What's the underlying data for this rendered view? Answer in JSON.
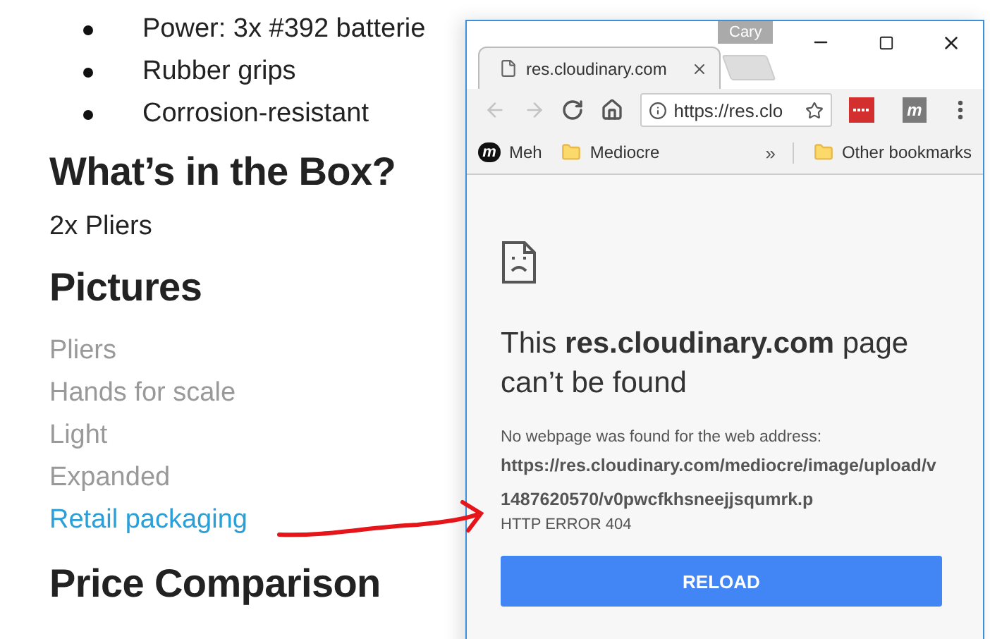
{
  "article": {
    "bullets": [
      "Power: 3x #392 batterie",
      "Rubber grips",
      "Corrosion-resistant"
    ],
    "box_heading": "What’s in the Box?",
    "box_items": [
      "2x Pliers"
    ],
    "pictures_heading": "Pictures",
    "picture_links": [
      {
        "label": "Pliers",
        "selected": false
      },
      {
        "label": "Hands for scale",
        "selected": false
      },
      {
        "label": "Light",
        "selected": false
      },
      {
        "label": "Expanded",
        "selected": false
      },
      {
        "label": "Retail packaging",
        "selected": true
      }
    ],
    "price_heading": "Price Comparison"
  },
  "browser": {
    "profile": "Cary",
    "tabs": [
      {
        "title": "res.cloudinary.com",
        "selected": true
      }
    ],
    "nav_buttons": [
      {
        "kind": "back",
        "disabled": true
      },
      {
        "kind": "forward",
        "disabled": true
      },
      {
        "kind": "reload",
        "disabled": false
      },
      {
        "kind": "home",
        "disabled": false
      }
    ],
    "address": "https://res.clo",
    "extensions": [
      {
        "kind": "dots",
        "color": "#d32f2f"
      },
      {
        "kind": "letter",
        "label": "m",
        "color": "#7a7a7a"
      }
    ],
    "bookmarks": [
      {
        "kind": "site",
        "icon_letter": "m",
        "label": "Meh"
      },
      {
        "kind": "folder",
        "label": "Mediocre"
      }
    ],
    "bookmarks_overflow": "»",
    "other_bookmarks": "Other bookmarks",
    "error": {
      "heading": "This **res.cloudinary.com** page can’t be found",
      "description": "No webpage was found for the web address:",
      "url": "https://res.cloudinary.com/mediocre/image/upload/v1487620570/v0pwcfkhsneejjsqumrk.p",
      "code": "HTTP ERROR 404",
      "button": "RELOAD"
    }
  }
}
